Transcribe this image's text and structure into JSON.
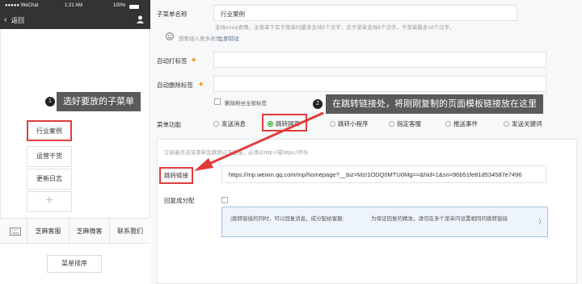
{
  "phone": {
    "status_left": "●●●●● WeChat",
    "time": "1:21 AM",
    "battery": "100%",
    "back_label": "返回",
    "submenu_items": [
      "行业案例",
      "运营干货",
      "更新日志"
    ],
    "add_icon": "plus-icon",
    "bottom_items": [
      "芝麻客服",
      "芝麻微客",
      "联系我们"
    ],
    "sort_button": "菜单排序"
  },
  "callouts": {
    "one_number": "1",
    "one_text": "选好要放的子菜单",
    "two_number": "2",
    "two_text": "在跳转链接处，将刚刚复制的页面模板链接放在这里"
  },
  "form": {
    "name_label": "子菜单名称",
    "name_value": "行业案例",
    "name_hint": "支持emoji表情，主菜单下有子菜单时最多支持5个汉字，无子菜单支持8个汉字。子菜单最多18个汉字。",
    "emoji_hint": "想要插入更多表情，",
    "emoji_link": "立即前往",
    "auto_tag_label": "自动打标签",
    "auto_remove_label": "自动删除标签",
    "remove_all_label": "删除粉丝全部标签",
    "func_label": "菜单功能",
    "options": [
      "发送消息",
      "跳转网页",
      "跳转小程序",
      "指定客服",
      "推送事件",
      "发送关键词"
    ],
    "selected_option": "跳转网页",
    "content_hint": "订阅者点击该菜单会跳到以下链接，必须以http://或https://开头",
    "jump_label": "跳转链接",
    "jump_value": "https://mp.weixin.qq.com/mp/homepage?__biz=MzI1ODQ0MTU0Mg==&hid=1&sn=96b51fe81d534587e7496",
    "reply_label": "回复成分配",
    "reply_note_left": "(跳转链接的同时，可以回复消息，成分配给客服:",
    "reply_note_right": "为保证回复的精准，请勿在多个菜单内设置相同的跳转链接",
    "reply_note_end": ")"
  },
  "colors": {
    "accent_red": "#e03c3c",
    "wechat_green": "#1aad19",
    "link_blue": "#576b95",
    "warn_orange": "#f0a030"
  }
}
